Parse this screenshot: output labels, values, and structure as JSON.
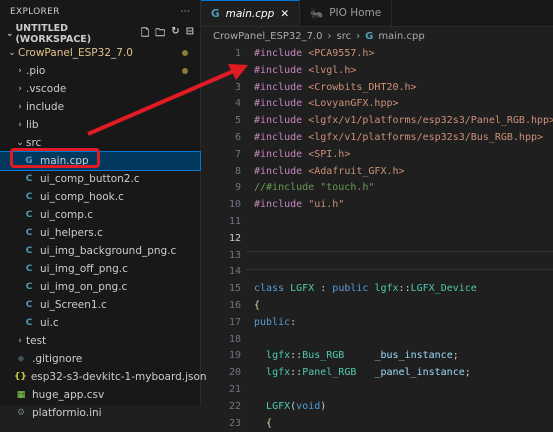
{
  "explorer": {
    "title": "EXPLORER",
    "more_icon": "ellipsis-icon",
    "workspace": "UNTITLED (WORKSPACE)",
    "folder": "CrowPanel_ESP32_7.0",
    "items": [
      {
        "label": ".pio",
        "type": "folder"
      },
      {
        "label": ".vscode",
        "type": "folder"
      },
      {
        "label": "include",
        "type": "folder"
      },
      {
        "label": "lib",
        "type": "folder"
      },
      {
        "label": "src",
        "type": "folder-open"
      },
      {
        "label": "main.cpp",
        "type": "cpp"
      },
      {
        "label": "ui_comp_button2.c",
        "type": "c"
      },
      {
        "label": "ui_comp_hook.c",
        "type": "c"
      },
      {
        "label": "ui_comp.c",
        "type": "c"
      },
      {
        "label": "ui_helpers.c",
        "type": "c"
      },
      {
        "label": "ui_img_background_png.c",
        "type": "c"
      },
      {
        "label": "ui_img_off_png.c",
        "type": "c"
      },
      {
        "label": "ui_img_on_png.c",
        "type": "c"
      },
      {
        "label": "ui_Screen1.c",
        "type": "c"
      },
      {
        "label": "ui.c",
        "type": "c"
      },
      {
        "label": "test",
        "type": "folder"
      },
      {
        "label": ".gitignore",
        "type": "git"
      },
      {
        "label": "esp32-s3-devkitc-1-myboard.json",
        "type": "json"
      },
      {
        "label": "huge_app.csv",
        "type": "csv"
      },
      {
        "label": "platformio.ini",
        "type": "ini"
      }
    ]
  },
  "tabs": [
    {
      "label": "main.cpp",
      "icon": "cpp-file-icon",
      "active": true
    },
    {
      "label": "PIO Home",
      "icon": "platformio-icon",
      "active": false
    }
  ],
  "breadcrumb": {
    "folder": "CrowPanel_ESP32_7.0",
    "sub": "src",
    "file": "main.cpp"
  },
  "code": {
    "line_numbers": [
      "1",
      "2",
      "3",
      "4",
      "5",
      "6",
      "7",
      "8",
      "9",
      "10",
      "11",
      "12",
      "13",
      "14",
      "15",
      "16",
      "17",
      "18",
      "19",
      "20",
      "21",
      "22",
      "23"
    ],
    "lines": [
      "#include <PCA9557.h>",
      "#include <lvgl.h>",
      "#include <Crowbits_DHT20.h>",
      "#include <LovyanGFX.hpp>",
      "#include <lgfx/v1/platforms/esp32s3/Panel_RGB.hpp>",
      "#include <lgfx/v1/platforms/esp32s3/Bus_RGB.hpp>",
      "#include <SPI.h>",
      "#include <Adafruit_GFX.h>",
      "//#include \"touch.h\"",
      "#include \"ui.h\"",
      "",
      "",
      "",
      "",
      "class LGFX : public lgfx::LGFX_Device",
      "{",
      "public:",
      "",
      "  lgfx::Bus_RGB     _bus_instance;",
      "  lgfx::Panel_RGB   _panel_instance;",
      "",
      "  LGFX(void)",
      "  {"
    ]
  },
  "colors": {
    "accent": "#0078d4",
    "highlight": "#e01b24"
  }
}
